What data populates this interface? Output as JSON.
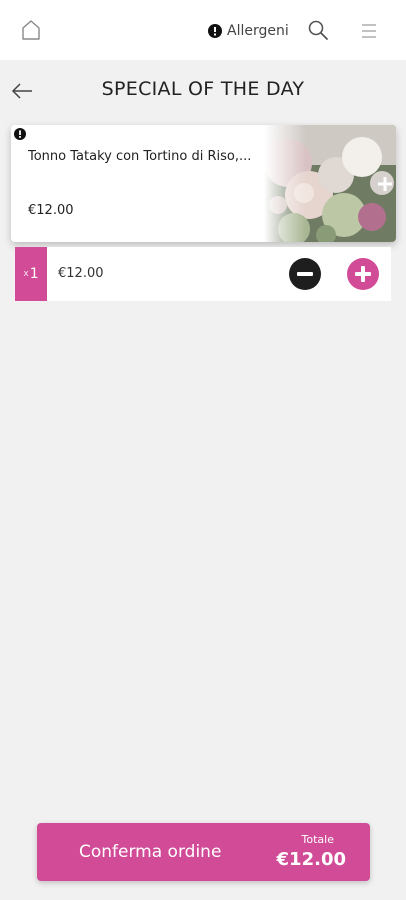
{
  "header": {
    "allergen_label": "Allergeni",
    "icons": [
      "home-icon",
      "alert-icon",
      "search-icon",
      "menu-icon"
    ]
  },
  "page": {
    "title": "SPECIAL OF THE DAY"
  },
  "item": {
    "name": "Tonno Tataky con Tortino di Riso,...",
    "price": "€12.00",
    "quantity": "1",
    "quantity_prefix": "x",
    "line_price": "€12.00"
  },
  "footer": {
    "confirm_label": "Conferma ordine",
    "total_label": "Totale",
    "total_value": "€12.00"
  },
  "colors": {
    "accent": "#d14b97",
    "dark": "#1e1e1e",
    "background": "#f1f1f1"
  }
}
